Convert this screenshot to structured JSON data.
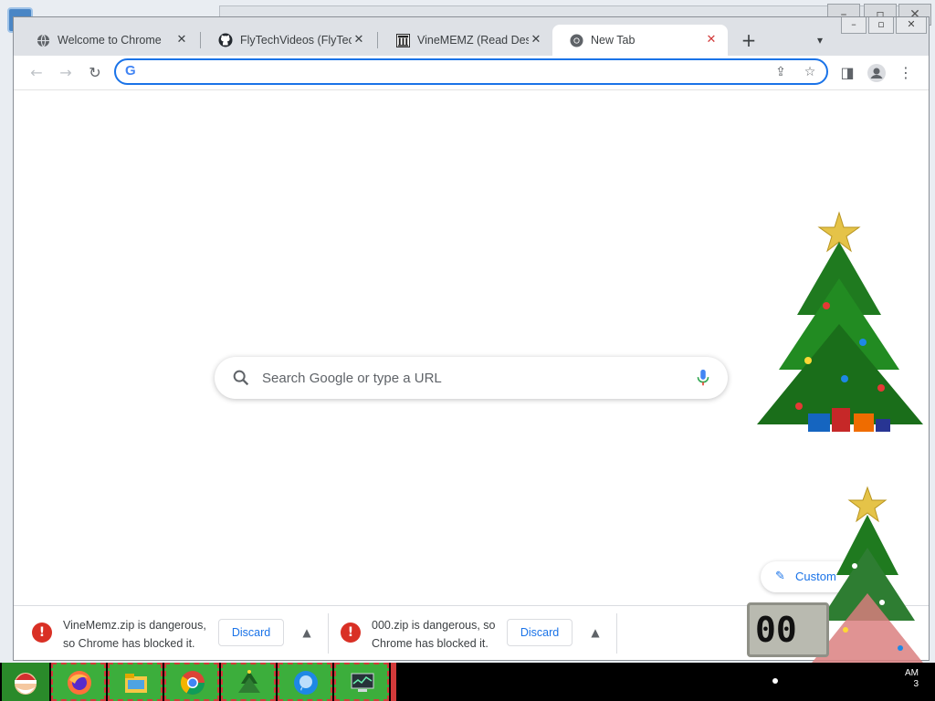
{
  "tabs": [
    {
      "title": "Welcome to Chrome",
      "icon": "globe-icon"
    },
    {
      "title": "FlyTechVideos (FlyTech Videos)",
      "icon": "github-icon"
    },
    {
      "title": "VineMEMZ (Read Description)",
      "icon": "archive-icon"
    },
    {
      "title": "New Tab",
      "icon": "chrome-icon",
      "active": true
    }
  ],
  "tab_close_glyph": "✕",
  "omnibox": {
    "value": "",
    "placeholder": ""
  },
  "ntp": {
    "search_placeholder": "Search Google or type a URL",
    "customize_label": "Custom"
  },
  "downloads": [
    {
      "message": "VineMemz.zip is dangerous, so Chrome has blocked it.",
      "action": "Discard"
    },
    {
      "message": "000.zip is dangerous, so Chrome has blocked it.",
      "action": "Discard"
    }
  ],
  "clock_widget": {
    "text": "00"
  },
  "tray": {
    "time_line1": "AM",
    "time_line2": "3"
  },
  "colors": {
    "accent": "#1a73e8",
    "danger": "#d93025",
    "taskbar_app": "#3cae3c"
  }
}
